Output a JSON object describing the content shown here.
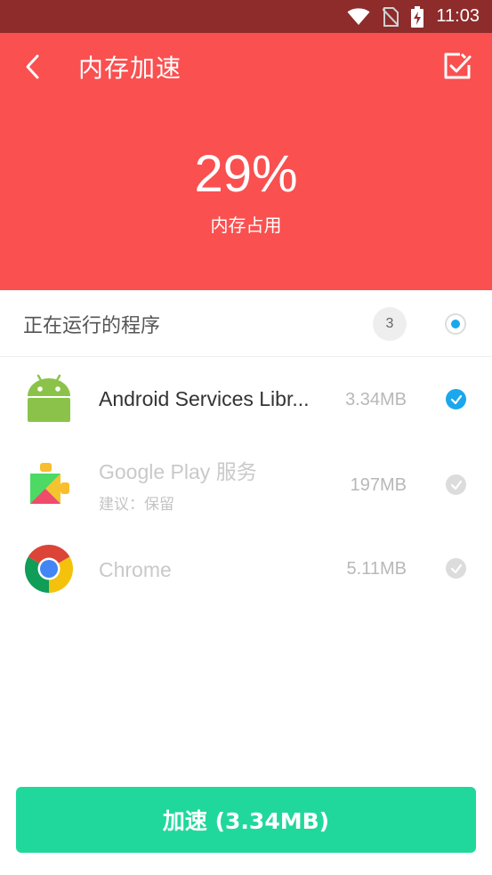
{
  "status_bar": {
    "time": "11:03",
    "icons": [
      "wifi-icon",
      "no-sim-icon",
      "battery-charging-icon"
    ]
  },
  "header": {
    "title": "内存加速",
    "usage_value": "29%",
    "usage_label": "内存占用",
    "background_color": "#fa5050",
    "icons": [
      "back-arrow-icon",
      "checklist-icon"
    ]
  },
  "running": {
    "title": "正在运行的程序",
    "count": "3"
  },
  "apps": [
    {
      "name": "Android Services Libr...",
      "size": "3.34MB",
      "subtitle": "",
      "checked": true,
      "icon": "android-robot-icon"
    },
    {
      "name": "Google Play 服务",
      "size": "197MB",
      "subtitle": "建议：保留",
      "checked": false,
      "icon": "google-play-services-icon"
    },
    {
      "name": "Chrome",
      "size": "5.11MB",
      "subtitle": "",
      "checked": false,
      "icon": "chrome-icon"
    }
  ],
  "boost_button": {
    "label": "加速 (3.34MB)",
    "color": "#20d89b"
  }
}
